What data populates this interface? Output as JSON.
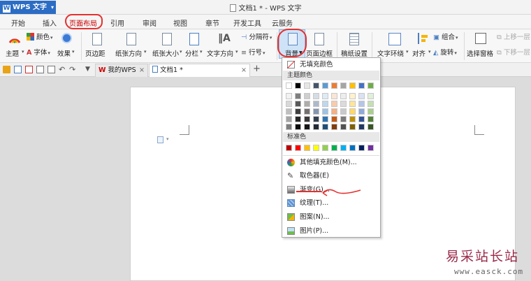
{
  "app": {
    "name": "WPS 文字",
    "window_title": "文档1 * - WPS 文字"
  },
  "menubar": {
    "items": [
      "开始",
      "插入",
      "页面布局",
      "引用",
      "审阅",
      "视图",
      "章节",
      "开发工具",
      "云服务"
    ],
    "active": "页面布局"
  },
  "ribbon": {
    "theme": "主题",
    "colors": "颜色",
    "fonts": "字体",
    "effects": "效果",
    "margins": "页边距",
    "orientation": "纸张方向",
    "size": "纸张大小",
    "columns": "分栏",
    "text_direction": "文字方向",
    "breaks": "分隔符",
    "line_numbers": "行号",
    "background": "背景",
    "page_borders": "页面边框",
    "paper_setup": "稿纸设置",
    "text_wrap": "文字环绕",
    "align": "对齐",
    "group": "组合",
    "rotate": "旋转",
    "selection_pane": "选择窗格",
    "bring_forward": "上移一层",
    "send_backward": "下移一层"
  },
  "tabs": [
    {
      "label": "我的WPS",
      "close": "×"
    },
    {
      "label": "文档1 *",
      "close": "×"
    }
  ],
  "new_tab": "+",
  "dropdown": {
    "no_fill": "无填充颜色",
    "theme_colors_title": "主题颜色",
    "standard_colors_title": "标准色",
    "theme_top_row": [
      "#ffffff",
      "#000000",
      "#e7e6e6",
      "#44546a",
      "#5b9bd5",
      "#ed7d31",
      "#a5a5a5",
      "#ffc000",
      "#4472c4",
      "#70ad47"
    ],
    "theme_shades": [
      [
        "#f2f2f2",
        "#7f7f7f",
        "#d0cece",
        "#d6dce4",
        "#deebf6",
        "#fbe5d5",
        "#ededed",
        "#fff2cc",
        "#dae3f3",
        "#e2efda"
      ],
      [
        "#d8d8d8",
        "#595959",
        "#aeabab",
        "#adb9ca",
        "#bdd7ee",
        "#f7cbac",
        "#dbdbdb",
        "#fee599",
        "#b4c6e7",
        "#c5e0b3"
      ],
      [
        "#bfbfbf",
        "#3f3f3f",
        "#757070",
        "#8496b0",
        "#9dc3e6",
        "#f4b183",
        "#c9c9c9",
        "#ffd965",
        "#8eaadb",
        "#a8d08d"
      ],
      [
        "#a5a5a5",
        "#262626",
        "#3a3838",
        "#323f4f",
        "#2e75b5",
        "#c55a11",
        "#7b7b7b",
        "#bf9000",
        "#2f5496",
        "#538135"
      ],
      [
        "#7f7f7f",
        "#0c0c0c",
        "#171616",
        "#222a35",
        "#1e4e79",
        "#833c0b",
        "#525252",
        "#7f6000",
        "#1f3864",
        "#375623"
      ]
    ],
    "standard": [
      "#c00000",
      "#ff0000",
      "#ffc000",
      "#ffff00",
      "#92d050",
      "#00b050",
      "#00b0f0",
      "#0070c0",
      "#002060",
      "#7030a0"
    ],
    "items": [
      {
        "label": "其他填充颜色(M)...",
        "icon": "palette-icon"
      },
      {
        "label": "取色器(E)",
        "icon": "eyedropper-icon"
      },
      {
        "label": "渐变(G)...",
        "icon": "gradient-icon"
      },
      {
        "label": "纹理(T)...",
        "icon": "texture-icon"
      },
      {
        "label": "图案(N)...",
        "icon": "pattern-icon"
      },
      {
        "label": "图片(P)...",
        "icon": "picture-icon"
      }
    ]
  },
  "watermark": {
    "line1": "易采站长站",
    "line2": "www.easck.com"
  },
  "colors": {
    "accent": "#2b6cc4",
    "annotation": "#e53030"
  }
}
